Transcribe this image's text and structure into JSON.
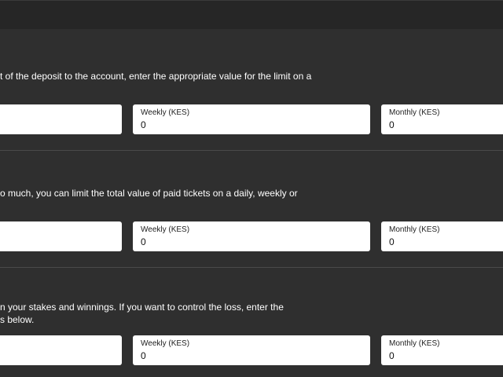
{
  "deposit_limit": {
    "description_line1": "t of the deposit to the account, enter the appropriate value for the limit on a",
    "fields": {
      "weekly_label": "Weekly (KES)",
      "weekly_value": "0",
      "monthly_label": "Monthly (KES)",
      "monthly_value": "0"
    }
  },
  "stake_limit": {
    "description_line1": "o much, you can limit the total value of paid tickets on a daily, weekly or",
    "fields": {
      "weekly_label": "Weekly (KES)",
      "weekly_value": "0",
      "monthly_label": "Monthly (KES)",
      "monthly_value": "0"
    }
  },
  "loss_limit": {
    "description_line1": "n your stakes and winnings. If you want to control the loss, enter the",
    "description_line2": "s below.",
    "fields": {
      "weekly_label": "Weekly (KES)",
      "weekly_value": "0",
      "monthly_label": "Monthly (KES)",
      "monthly_value": "0"
    }
  }
}
